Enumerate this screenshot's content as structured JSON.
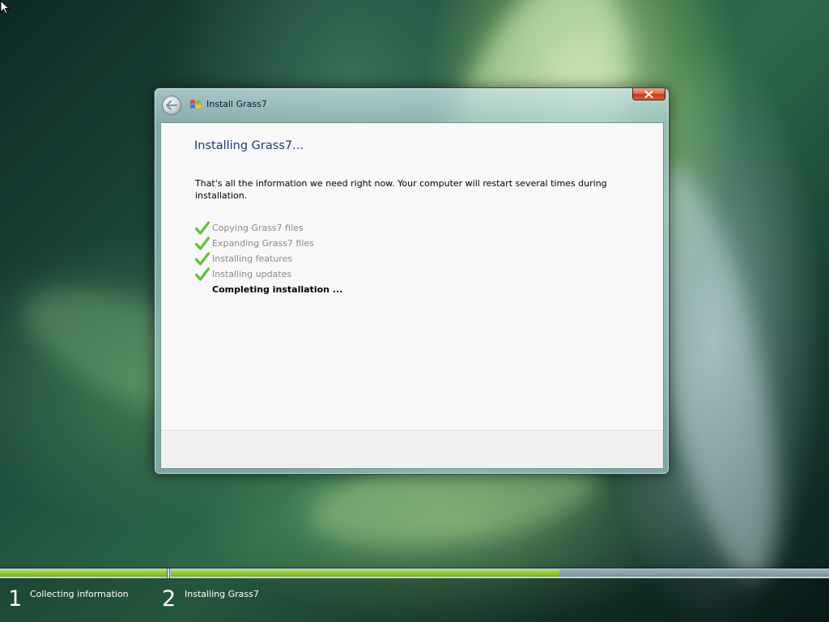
{
  "window": {
    "title": "Install Grass7",
    "heading": "Installing Grass7...",
    "description": "That's all the information we need right now. Your computer will restart several times during installation."
  },
  "steps": [
    {
      "label": "Copying Grass7 files",
      "status": "done"
    },
    {
      "label": "Expanding Grass7 files",
      "status": "done"
    },
    {
      "label": "Installing features",
      "status": "done"
    },
    {
      "label": "Installing updates",
      "status": "done"
    },
    {
      "label": "Completing installation ...",
      "status": "current"
    }
  ],
  "phases": [
    {
      "number": "1",
      "label": "Collecting information",
      "progress": 1.0
    },
    {
      "number": "2",
      "label": "Installing Grass7",
      "progress": 0.59
    }
  ],
  "colors": {
    "progress_fill": "#8ec63f",
    "check": "#5fbf3a",
    "heading": "#1f3a78",
    "close_button": "#c94a2c"
  },
  "icons": {
    "back": "back-arrow-icon",
    "title": "windows-flag-icon",
    "close": "close-icon",
    "check": "checkmark-icon",
    "cursor": "mouse-pointer-icon"
  }
}
